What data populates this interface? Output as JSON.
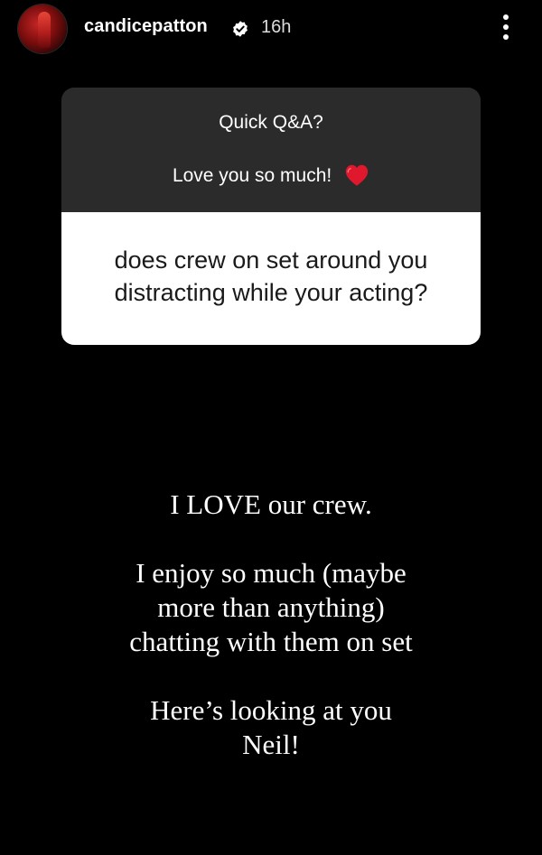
{
  "header": {
    "username": "candicepatton",
    "verified": true,
    "time": "16h",
    "more_icon": "more-vertical-icon"
  },
  "qa": {
    "title": "Quick Q&A?",
    "subtitle": "Love you so much!",
    "subtitle_icon": "red-heart-icon",
    "question_line1": "does crew on set around you",
    "question_line2": "distracting while your acting?"
  },
  "answer": {
    "p1": "I LOVE our crew.",
    "p2_line1": "I enjoy so much (maybe",
    "p2_line2": "more than anything)",
    "p2_line3": "chatting with them on set",
    "p3_line1": "Here’s looking at you",
    "p3_line2": "Neil!"
  },
  "colors": {
    "background": "#000000",
    "card_top": "#2b2b2b",
    "card_bottom": "#ffffff",
    "heart": "#e0182d"
  }
}
